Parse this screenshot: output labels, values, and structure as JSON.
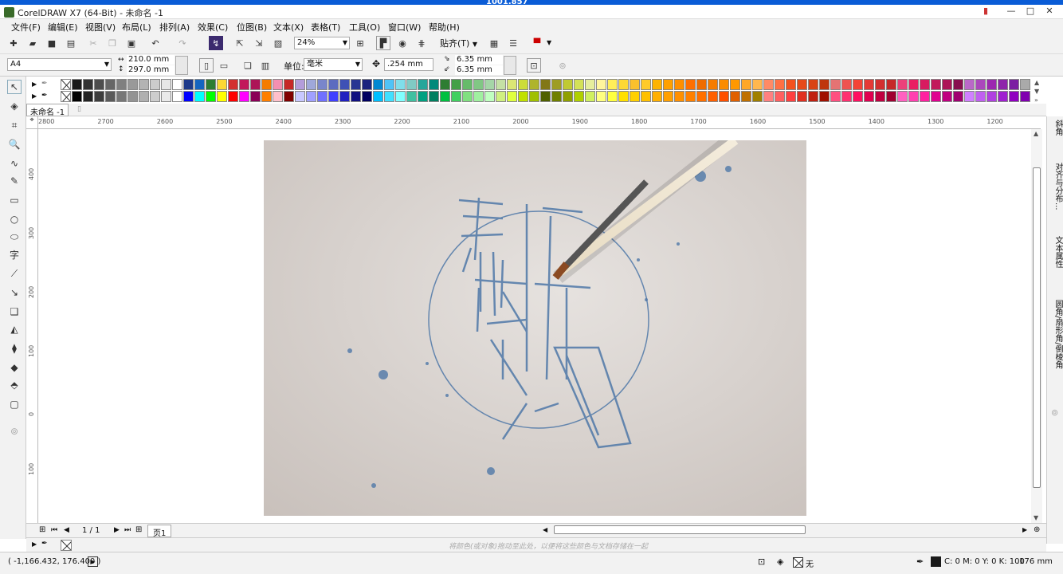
{
  "screen": {
    "top_text": "1001.857"
  },
  "window": {
    "title": "CorelDRAW X7 (64-Bit) - 未命名 -1",
    "minimize": "—",
    "maximize": "□",
    "close": "✕"
  },
  "menu": [
    "文件(F)",
    "编辑(E)",
    "视图(V)",
    "布局(L)",
    "排列(A)",
    "效果(C)",
    "位图(B)",
    "文本(X)",
    "表格(T)",
    "工具(O)",
    "窗口(W)",
    "帮助(H)"
  ],
  "toolbar": {
    "zoom": "24%",
    "snap": "贴齐(T)"
  },
  "property_bar": {
    "page_size": "A4",
    "width": "210.0 mm",
    "height": "297.0 mm",
    "units_label": "单位:",
    "units": "毫米",
    "nudge": ".254 mm",
    "dup_x": "6.35 mm",
    "dup_y": "6.35 mm"
  },
  "document": {
    "tab": "未命名 -1"
  },
  "ruler": {
    "h_ticks": [
      "2800",
      "2700",
      "2600",
      "2500",
      "2400",
      "2300",
      "2200",
      "2100",
      "2000",
      "1900",
      "1800",
      "1700",
      "1600",
      "1500",
      "1400",
      "1300",
      "1200"
    ],
    "v_ticks": [
      "400",
      "300",
      "200",
      "100",
      "0",
      "100"
    ]
  },
  "colors": {
    "row1": [
      "#1a1a1a",
      "#333333",
      "#4d4d4d",
      "#666666",
      "#808080",
      "#999999",
      "#b3b3b3",
      "#cccccc",
      "#e6e6e6",
      "#ffffff",
      "#1e3a8a",
      "#1565c0",
      "#2e7d32",
      "#fdd835",
      "#d32f2f",
      "#c2185b",
      "#ad1457",
      "#f57c00",
      "#f48fb1",
      "#c62828",
      "#b39ddb",
      "#9fa8da",
      "#7986cb",
      "#5c6bc0",
      "#3f51b5",
      "#283593",
      "#1a237e",
      "#0288d1",
      "#4fc3f7",
      "#80deea",
      "#80cbc4",
      "#26a69a",
      "#00897b",
      "#2e7d32",
      "#43a047",
      "#66bb6a",
      "#81c784",
      "#a5d6a7",
      "#c5e1a5",
      "#dce775",
      "#cddc39",
      "#afb42b",
      "#827717",
      "#9e9d24",
      "#c0ca33",
      "#d4e157",
      "#e6ee9c",
      "#fff59d",
      "#ffee58",
      "#fdd835",
      "#fbc02d",
      "#ffca28",
      "#ffb300",
      "#ffa000",
      "#ff8f00",
      "#ff6f00",
      "#ef6c00",
      "#f57c00",
      "#fb8c00",
      "#ff9800",
      "#ffa726",
      "#ffb74d",
      "#ff8a65",
      "#ff7043",
      "#f4511e",
      "#e64a19",
      "#d84315",
      "#bf360c",
      "#e57373",
      "#ef5350",
      "#f44336",
      "#e53935",
      "#d32f2f",
      "#c62828",
      "#ec407a",
      "#e91e63",
      "#d81b60",
      "#c2185b",
      "#ad1457",
      "#880e4f",
      "#ba68c8",
      "#ab47bc",
      "#9c27b0",
      "#8e24aa",
      "#7b1fa2",
      "#aaaaaa"
    ],
    "row2": [
      "#000000",
      "#222222",
      "#3d3d3d",
      "#5a5a5a",
      "#777777",
      "#939393",
      "#b0b0b0",
      "#cdcdcd",
      "#eaeaea",
      "#ffffff",
      "#0000ff",
      "#00ffff",
      "#00ff00",
      "#ffff00",
      "#ff0000",
      "#ff00ff",
      "#8b0057",
      "#ff7f00",
      "#ffc0cb",
      "#800000",
      "#c8c8ff",
      "#a0a0ff",
      "#7070ff",
      "#4040ff",
      "#2020c0",
      "#101080",
      "#000060",
      "#00c0ff",
      "#40e0ff",
      "#80ffff",
      "#40c0a0",
      "#00a080",
      "#008060",
      "#00c040",
      "#40d060",
      "#80e080",
      "#a0f0a0",
      "#c0ffc0",
      "#d0f080",
      "#e0ff40",
      "#c0e000",
      "#a0c000",
      "#506000",
      "#708000",
      "#90a000",
      "#b0d000",
      "#d0f060",
      "#ffff80",
      "#ffff40",
      "#ffe000",
      "#ffd000",
      "#ffc000",
      "#ffb000",
      "#ffa000",
      "#ff9000",
      "#ff8000",
      "#ff7000",
      "#ff6000",
      "#ff5000",
      "#e06000",
      "#c07000",
      "#a08000",
      "#ff8080",
      "#ff6060",
      "#ff4040",
      "#e03020",
      "#c02010",
      "#a01000",
      "#ff5080",
      "#ff3070",
      "#ff1060",
      "#e00050",
      "#c00040",
      "#a00030",
      "#ff60c0",
      "#ff40b0",
      "#ff20a0",
      "#e00090",
      "#c00080",
      "#a00070",
      "#d080ff",
      "#c060f0",
      "#b040e0",
      "#a020d0",
      "#9000c0",
      "#8000b0"
    ]
  },
  "page_nav": {
    "pages": "1 / 1",
    "page_tab": "页1"
  },
  "doc_palette_hint": "将颜色(或对象)拖动至此处，以便将这些颜色与文档存储在一起",
  "dock": [
    "斜角",
    "对齐与分布...",
    "文本属性",
    "圆角/扇形角/倒棱角"
  ],
  "status": {
    "coords": "( -1,166.432, 176.400 )",
    "fill": "无",
    "outline_color": "C: 0 M: 0 Y: 0 K: 100",
    "outline_width": ".176 mm"
  }
}
